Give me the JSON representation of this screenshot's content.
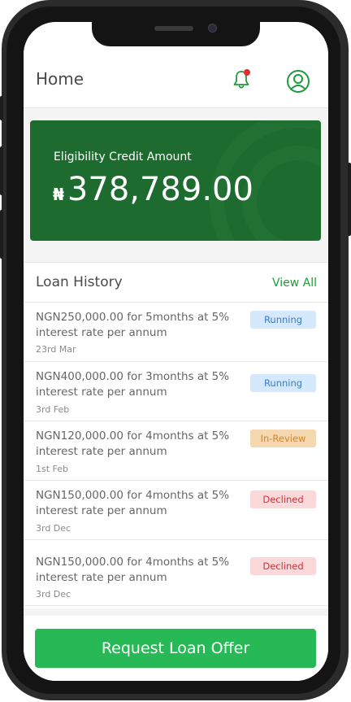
{
  "header": {
    "title": "Home",
    "icons": [
      "bell-icon",
      "user-icon"
    ],
    "notification_dot_color": "#e52b2b"
  },
  "credit": {
    "label": "Eligibility Credit Amount",
    "currency_symbol": "₦",
    "amount": "378,789.00"
  },
  "history": {
    "title": "Loan History",
    "view_all": "View All",
    "loans": [
      {
        "desc": "NGN250,000.00 for 5months at 5% interest rate per annum",
        "date": "23rd Mar",
        "status": "Running"
      },
      {
        "desc": "NGN400,000.00 for 3months at 5% interest rate per annum",
        "date": "3rd Feb",
        "status": "Running"
      },
      {
        "desc": "NGN120,000.00 for 4months at 5% interest rate per annum",
        "date": "1st Feb",
        "status": "In-Review"
      },
      {
        "desc": "NGN150,000.00 for 4months at 5% interest rate per annum",
        "date": "3rd Dec",
        "status": "Declined"
      },
      {
        "desc": "NGN150,000.00 for 4months at 5% interest rate per annum",
        "date": "3rd Dec",
        "status": "Declined"
      }
    ]
  },
  "cta": {
    "label": "Request Loan Offer"
  },
  "colors": {
    "brand_green": "#1e6b2f",
    "cta_green": "#26b955",
    "accent_green": "#1f9a3d"
  }
}
